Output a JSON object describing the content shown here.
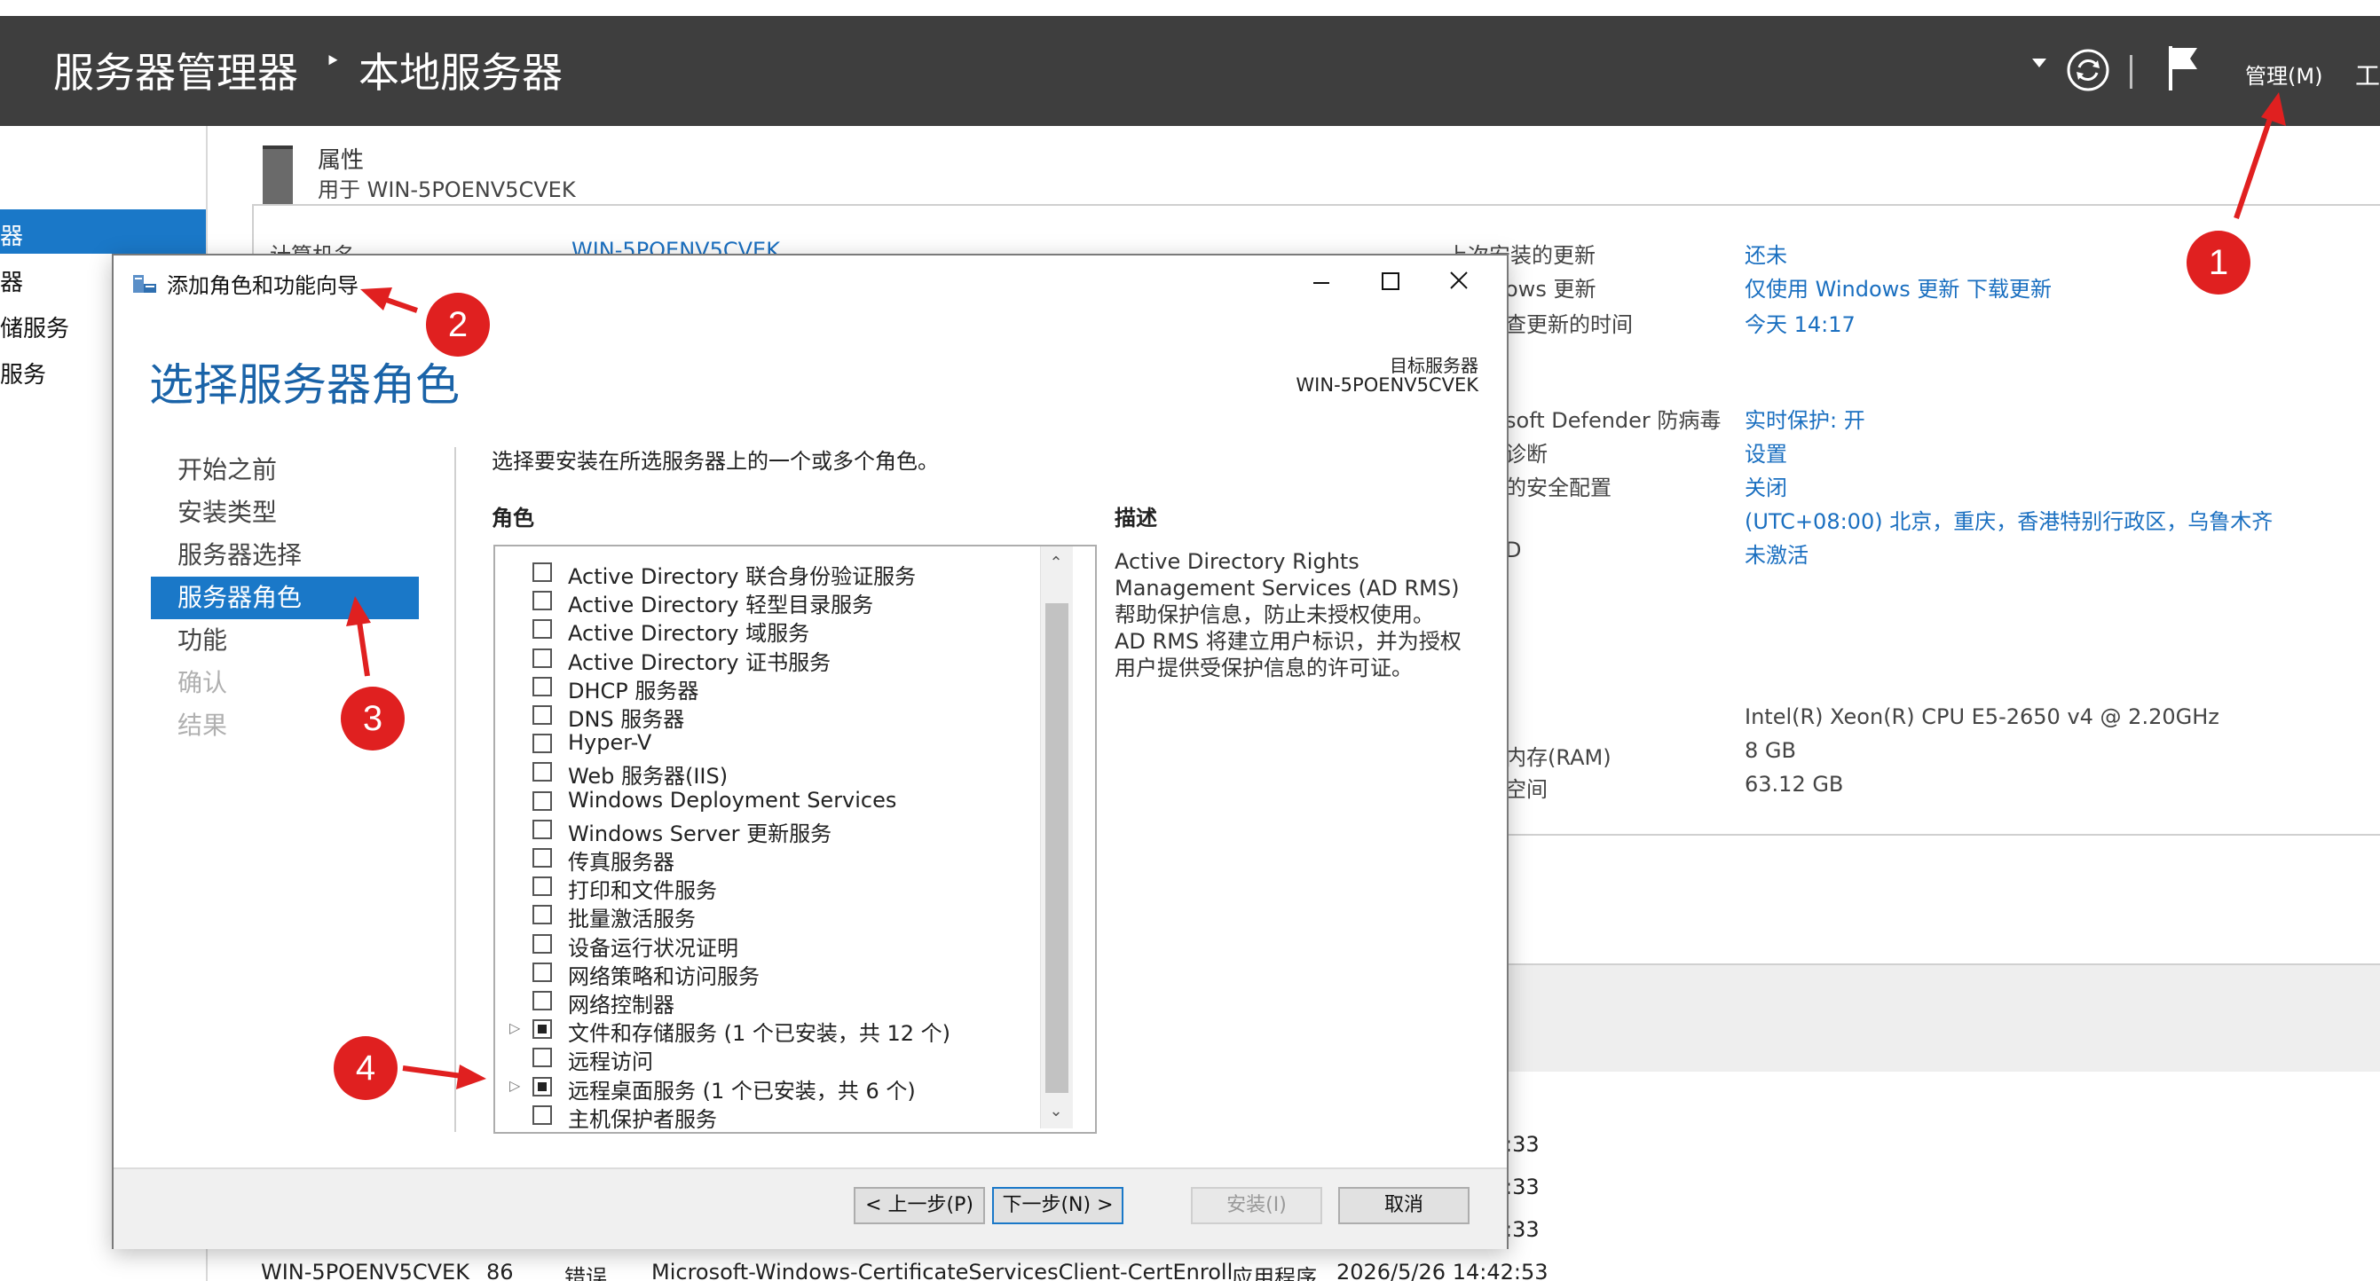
{
  "header": {
    "app_title": "服务器管理器",
    "separator": "‣",
    "page_title": "本地服务器",
    "manage_menu": "管理(M)",
    "tools_menu": "工"
  },
  "left_nav": {
    "items": [
      "器",
      "器",
      "储服务",
      "服务"
    ]
  },
  "properties": {
    "title": "属性",
    "subtitle": "用于 WIN-5POENV5CVEK",
    "left_partial": {
      "computer_name_label": "计算机名",
      "computer_name_value": "WIN-5POENV5CVEK"
    },
    "right_labels": [
      "上次安装的更新",
      "ows 更新",
      "查更新的时间",
      "soft Defender 防病毒",
      "诊断",
      "的安全配置",
      "D",
      "",
      "内存(RAM)",
      "空间"
    ],
    "right_values": [
      "还未",
      "仅使用 Windows 更新 下载更新",
      "今天 14:17",
      "实时保护: 开",
      "设置",
      "关闭",
      "(UTC+08:00) 北京，重庆，香港特别行政区，乌鲁木齐",
      "未激活",
      "Intel(R) Xeon(R) CPU E5-2650 v4 @ 2.20GHz",
      "8 GB",
      "63.12 GB"
    ]
  },
  "events_partial": {
    "times": [
      ":33",
      ":33",
      ":33"
    ],
    "row": {
      "server": "WIN-5POENV5CVEK",
      "id": "86",
      "severity": "错误",
      "source": "Microsoft-Windows-CertificateServicesClient-CertEnroll",
      "log": "应用程序",
      "datetime": "2026/5/26 14:42:53"
    }
  },
  "wizard": {
    "title": "添加角色和功能向导",
    "heading": "选择服务器角色",
    "target_label": "目标服务器",
    "target_value": "WIN-5POENV5CVEK",
    "steps": [
      {
        "label": "开始之前",
        "state": "normal"
      },
      {
        "label": "安装类型",
        "state": "normal"
      },
      {
        "label": "服务器选择",
        "state": "normal"
      },
      {
        "label": "服务器角色",
        "state": "active"
      },
      {
        "label": "功能",
        "state": "normal"
      },
      {
        "label": "确认",
        "state": "disabled"
      },
      {
        "label": "结果",
        "state": "disabled"
      }
    ],
    "instruction": "选择要安装在所选服务器上的一个或多个角色。",
    "roles_header": "角色",
    "description_header": "描述",
    "description_lines": [
      "Active Directory Rights",
      "Management Services (AD RMS)",
      "帮助保护信息，防止未授权使用。",
      "AD RMS 将建立用户标识，并为授权",
      "用户提供受保护信息的许可证。"
    ],
    "roles": [
      {
        "label": "Active Directory 联合身份验证服务",
        "state": "unchecked",
        "expandable": false
      },
      {
        "label": "Active Directory 轻型目录服务",
        "state": "unchecked",
        "expandable": false
      },
      {
        "label": "Active Directory 域服务",
        "state": "unchecked",
        "expandable": false
      },
      {
        "label": "Active Directory 证书服务",
        "state": "unchecked",
        "expandable": false
      },
      {
        "label": "DHCP 服务器",
        "state": "unchecked",
        "expandable": false
      },
      {
        "label": "DNS 服务器",
        "state": "unchecked",
        "expandable": false
      },
      {
        "label": "Hyper-V",
        "state": "unchecked",
        "expandable": false
      },
      {
        "label": "Web 服务器(IIS)",
        "state": "unchecked",
        "expandable": false
      },
      {
        "label": "Windows Deployment Services",
        "state": "unchecked",
        "expandable": false
      },
      {
        "label": "Windows Server 更新服务",
        "state": "unchecked",
        "expandable": false
      },
      {
        "label": "传真服务器",
        "state": "unchecked",
        "expandable": false
      },
      {
        "label": "打印和文件服务",
        "state": "unchecked",
        "expandable": false
      },
      {
        "label": "批量激活服务",
        "state": "unchecked",
        "expandable": false
      },
      {
        "label": "设备运行状况证明",
        "state": "unchecked",
        "expandable": false
      },
      {
        "label": "网络策略和访问服务",
        "state": "unchecked",
        "expandable": false
      },
      {
        "label": "网络控制器",
        "state": "unchecked",
        "expandable": false
      },
      {
        "label": "文件和存储服务 (1 个已安装，共 12 个)",
        "state": "partial",
        "expandable": true
      },
      {
        "label": "远程访问",
        "state": "unchecked",
        "expandable": false
      },
      {
        "label": "远程桌面服务 (1 个已安装，共 6 个)",
        "state": "partial",
        "expandable": true
      },
      {
        "label": "主机保护者服务",
        "state": "unchecked",
        "expandable": false
      }
    ],
    "buttons": {
      "previous": "< 上一步(P)",
      "next": "下一步(N) >",
      "install": "安装(I)",
      "cancel": "取消"
    }
  },
  "annotations": {
    "badges": [
      "1",
      "2",
      "3",
      "4"
    ],
    "color": "#e02020"
  },
  "colors": {
    "title_bar": "#3e3e3e",
    "accent": "#1a78c8",
    "heading": "#1a63a8",
    "link": "#1a6fc0"
  }
}
